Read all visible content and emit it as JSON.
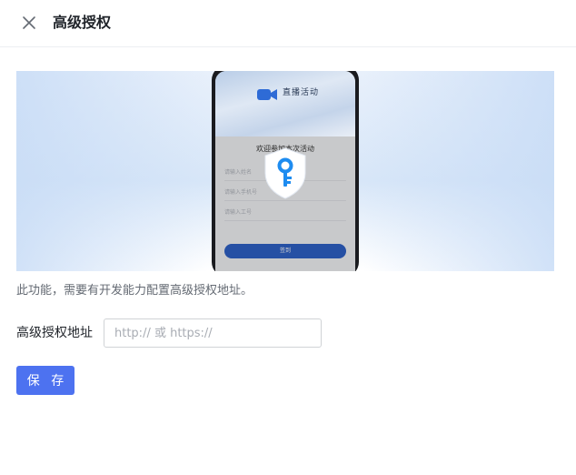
{
  "header": {
    "title": "高级授权",
    "close_icon": "close-icon"
  },
  "banner": {
    "app_name": "直播活动",
    "welcome_text": "欢迎参加本次活动",
    "input_hints": [
      "请输入姓名",
      "请输入手机号",
      "请输入工号"
    ],
    "button_label": "签到",
    "badge_icon": "key-shield-icon"
  },
  "main": {
    "description": "此功能，需要有开发能力配置高级授权地址。",
    "field_label": "高级授权地址",
    "url_placeholder": "http:// 或 https://",
    "url_value": "",
    "save_label": "保 存"
  },
  "colors": {
    "primary": "#4d72f0",
    "key_blue": "#1e8cf0"
  }
}
